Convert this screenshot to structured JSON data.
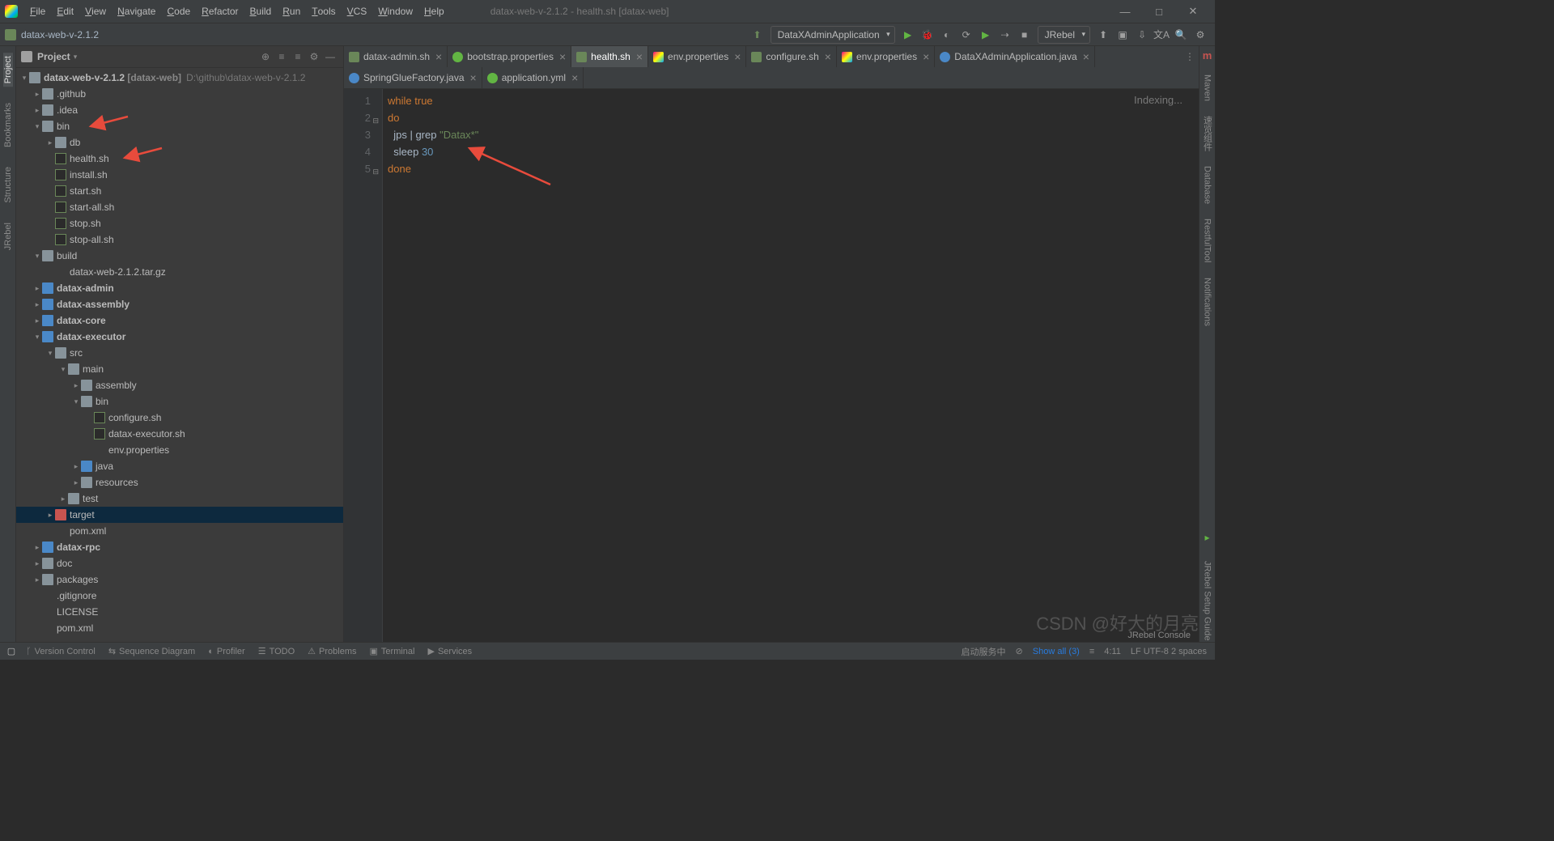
{
  "menu": {
    "items": [
      "File",
      "Edit",
      "View",
      "Navigate",
      "Code",
      "Refactor",
      "Build",
      "Run",
      "Tools",
      "VCS",
      "Window",
      "Help"
    ],
    "title": "datax-web-v-2.1.2 - health.sh [datax-web]"
  },
  "breadcrumb": "datax-web-v-2.1.2",
  "run_config": "DataXAdminApplication",
  "jrebel": "JRebel",
  "sidebar": {
    "title": "Project"
  },
  "tree": {
    "root": {
      "name": "datax-web-v-2.1.2",
      "tag": "[datax-web]",
      "path": "D:\\github\\datax-web-v-2.1.2"
    },
    "github": ".github",
    "idea": ".idea",
    "bin": "bin",
    "db": "db",
    "health": "health.sh",
    "install": "install.sh",
    "start": "start.sh",
    "startall": "start-all.sh",
    "stop": "stop.sh",
    "stopall": "stop-all.sh",
    "build": "build",
    "tar": "datax-web-2.1.2.tar.gz",
    "admin_f": "datax-admin",
    "assembly_f": "datax-assembly",
    "core_f": "datax-core",
    "executor_f": "datax-executor",
    "src": "src",
    "main": "main",
    "assembly": "assembly",
    "bin2": "bin",
    "configure": "configure.sh",
    "execsh": "datax-executor.sh",
    "envprops": "env.properties",
    "java": "java",
    "resources": "resources",
    "test": "test",
    "target": "target",
    "pom": "pom.xml",
    "rpc": "datax-rpc",
    "doc": "doc",
    "packages": "packages",
    "gitignore": ".gitignore",
    "license": "LICENSE",
    "pom2": "pom.xml"
  },
  "tabs": {
    "row1": [
      {
        "icon": "sh",
        "label": "datax-admin.sh"
      },
      {
        "icon": "prop",
        "label": "bootstrap.properties"
      },
      {
        "icon": "sh",
        "label": "health.sh",
        "active": true
      },
      {
        "icon": "cfg",
        "label": "env.properties"
      },
      {
        "icon": "sh",
        "label": "configure.sh"
      },
      {
        "icon": "cfg",
        "label": "env.properties"
      },
      {
        "icon": "java",
        "label": "DataXAdminApplication.java"
      }
    ],
    "row2": [
      {
        "icon": "java",
        "label": "SpringGlueFactory.java"
      },
      {
        "icon": "yml",
        "label": "application.yml"
      }
    ]
  },
  "code": {
    "lines": [
      {
        "n": 1,
        "html": "<span class='kw'>while</span> <span class='kw'>true</span>"
      },
      {
        "n": 2,
        "html": "<span class='kw'>do</span>",
        "fold": "-"
      },
      {
        "n": 3,
        "html": "  <span class='plain'>jps | grep </span><span class='str'>\"Datax*\"</span>"
      },
      {
        "n": 4,
        "html": "  <span class='plain'>sleep </span><span class='num'>30</span>"
      },
      {
        "n": 5,
        "html": "<span class='kw'>done</span>",
        "fold": "-"
      }
    ],
    "indexing": "Indexing..."
  },
  "status": {
    "left": [
      "Version Control",
      "Sequence Diagram",
      "Profiler",
      "TODO",
      "Problems",
      "Terminal",
      "Services"
    ],
    "right": {
      "srv": "启动服务中",
      "show": "Show all (3)",
      "pos": "4:11",
      "enc": "LF  UTF-8  2 spaces"
    },
    "jrebel": "JRebel Console"
  },
  "right_tabs": [
    "Maven",
    "速览组件",
    "Database",
    "RestfulTool",
    "Notifications"
  ],
  "left_tabs": [
    "Project",
    "Bookmarks",
    "Structure",
    "JRebel"
  ],
  "watermark": "CSDN @好大的月亮"
}
